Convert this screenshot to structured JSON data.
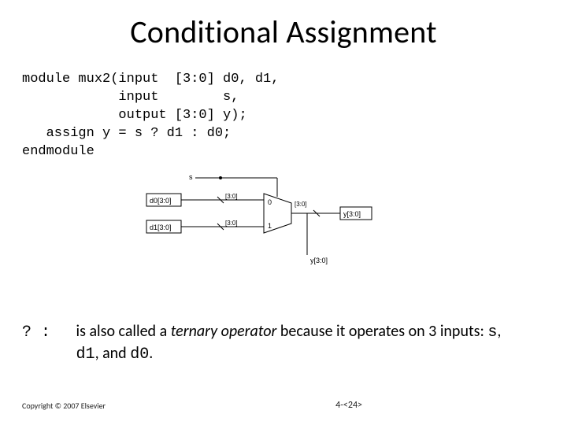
{
  "title": "Conditional Assignment",
  "code": {
    "l1": "module mux2(input  [3:0] d0, d1,",
    "l2": "            input        s,",
    "l3": "            output [3:0] y);",
    "l4": "   assign y = s ? d1 : d0;",
    "l5": "endmodule"
  },
  "diagram": {
    "s_label": "s",
    "d0_label": "d0[3:0]",
    "d1_label": "d1[3:0]",
    "y_label": "y[3:0]",
    "out_port": "y[3:0]",
    "bus_tag": "[3:0]",
    "mux0": "0",
    "mux1": "1"
  },
  "note": {
    "op": "? :",
    "pre": " is also called a ",
    "term": "ternary operator",
    "mid": " because it operates on 3 inputs: ",
    "s": "s",
    "c1": ", ",
    "d1": "d1",
    "c2": ", and ",
    "d0": "d0",
    "end": "."
  },
  "copyright": "Copyright © 2007 Elsevier",
  "pagenum": "4-<24>"
}
